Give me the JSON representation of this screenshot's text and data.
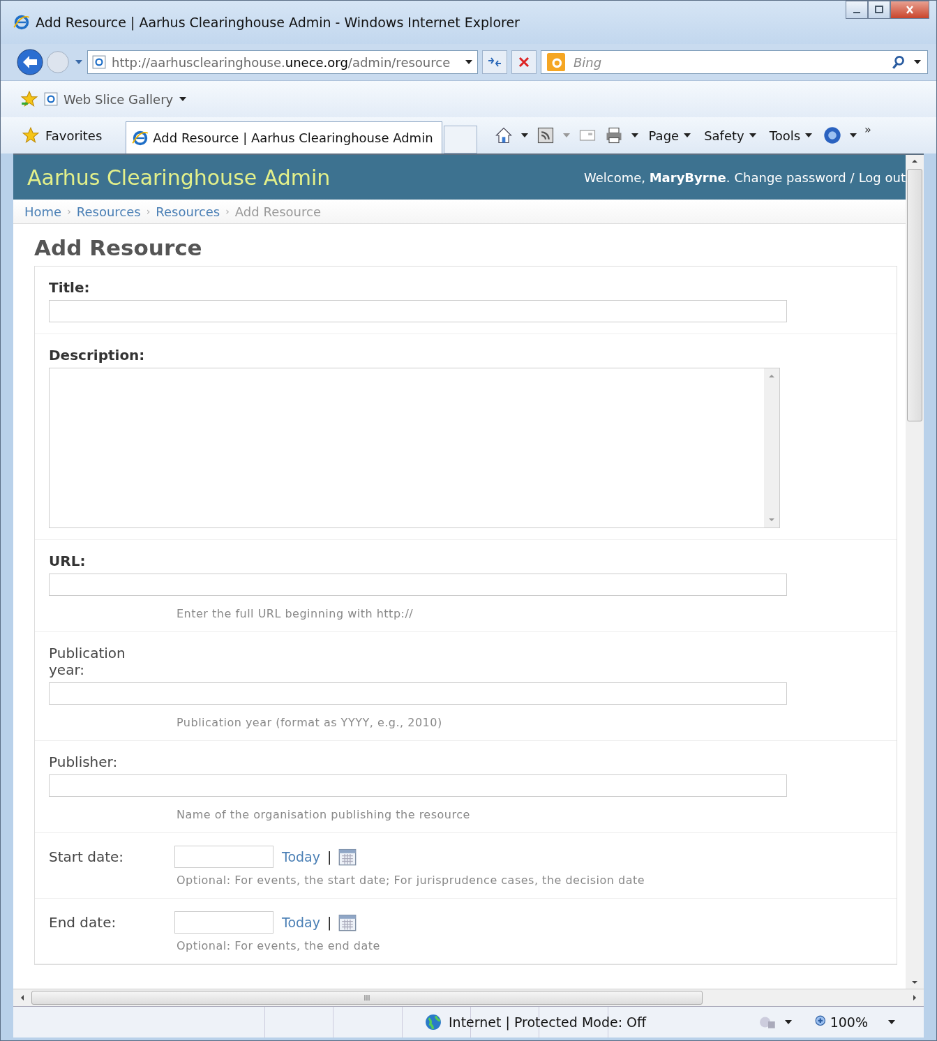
{
  "window": {
    "title": "Add Resource | Aarhus Clearinghouse Admin - Windows Internet Explorer"
  },
  "address_bar": {
    "url": "http://aarhusclearinghouse.**unece.org**/admin/resource"
  },
  "search": {
    "placeholder": "Bing"
  },
  "favorites_bar": {
    "items": [
      "Web Slice Gallery"
    ]
  },
  "tabs": [
    {
      "label": "Favorites",
      "kind": "favorites",
      "selected": false
    },
    {
      "label": "Add Resource | Aarhus Clearinghouse Admin",
      "kind": "page",
      "selected": true
    },
    {
      "kind": "new",
      "selected": false
    }
  ],
  "command_bar": {
    "menus": [
      "Page",
      "Safety",
      "Tools"
    ],
    "overflow": "»"
  },
  "page": {
    "site_title": "Aarhus Clearinghouse Admin",
    "welcome": "Welcome, **MaryByrne**.",
    "links": [
      "Change password",
      "/",
      "Log out"
    ],
    "breadcrumbs": [
      {
        "label": "Home",
        "selected": false
      },
      {
        "label": "Resources",
        "selected": false
      },
      {
        "label": "Resources",
        "selected": false
      },
      {
        "label": "Add Resource",
        "selected": true
      }
    ],
    "breadcrumb_separator": "›",
    "heading": "Add Resource",
    "fields": [
      {
        "kind": "text",
        "label": "Title:",
        "required": true
      },
      {
        "kind": "textarea",
        "label": "Description:",
        "required": true
      },
      {
        "kind": "text",
        "label": "URL:",
        "required": true,
        "help": "Enter the full URL beginning with http://"
      },
      {
        "kind": "text",
        "label": "Publication year:",
        "required": false,
        "help": "Publication year (format as YYYY, e.g., 2010)"
      },
      {
        "kind": "text",
        "label": "Publisher:",
        "required": false,
        "help": "Name of the organisation publishing the resource"
      },
      {
        "kind": "date",
        "label": "Start date:",
        "required": false,
        "link": "Today",
        "separator": "|",
        "help": "Optional: For events, the start date; For jurisprudence cases, the decision date"
      },
      {
        "kind": "date",
        "label": "End date:",
        "required": false,
        "link": "Today",
        "separator": "|",
        "help": "Optional: For events, the end date"
      }
    ]
  },
  "status_bar": {
    "zone": "Internet | Protected Mode: Off",
    "zoom": "100%",
    "scroll_grip": "III"
  }
}
